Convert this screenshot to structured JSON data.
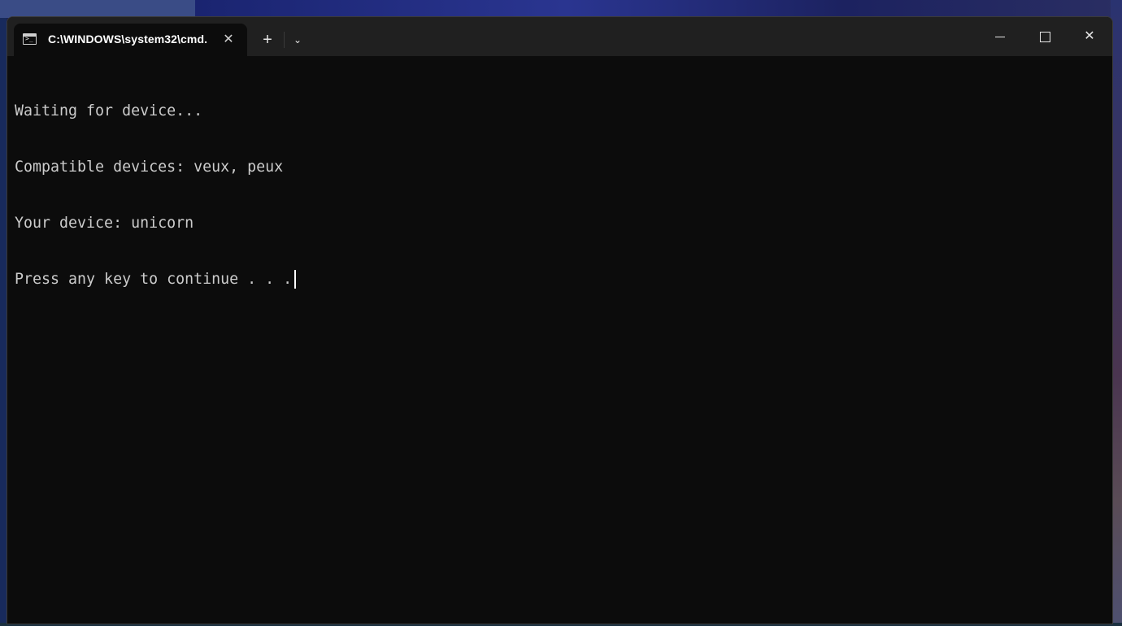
{
  "window": {
    "tab_title": "C:\\WINDOWS\\system32\\cmd.",
    "tab_icon": "terminal-icon",
    "tab_close": "✕",
    "new_tab": "+",
    "dropdown": "⌄",
    "controls": {
      "minimize_icon": "minimize-icon",
      "maximize_icon": "maximize-icon",
      "close": "✕"
    }
  },
  "console": {
    "lines": [
      "Waiting for device...",
      "Compatible devices: veux, peux",
      "Your device: unicorn",
      "Press any key to continue . . ."
    ]
  },
  "colors": {
    "background": "#0c0c0c",
    "titlebar": "#202020",
    "text": "#cccccc"
  }
}
